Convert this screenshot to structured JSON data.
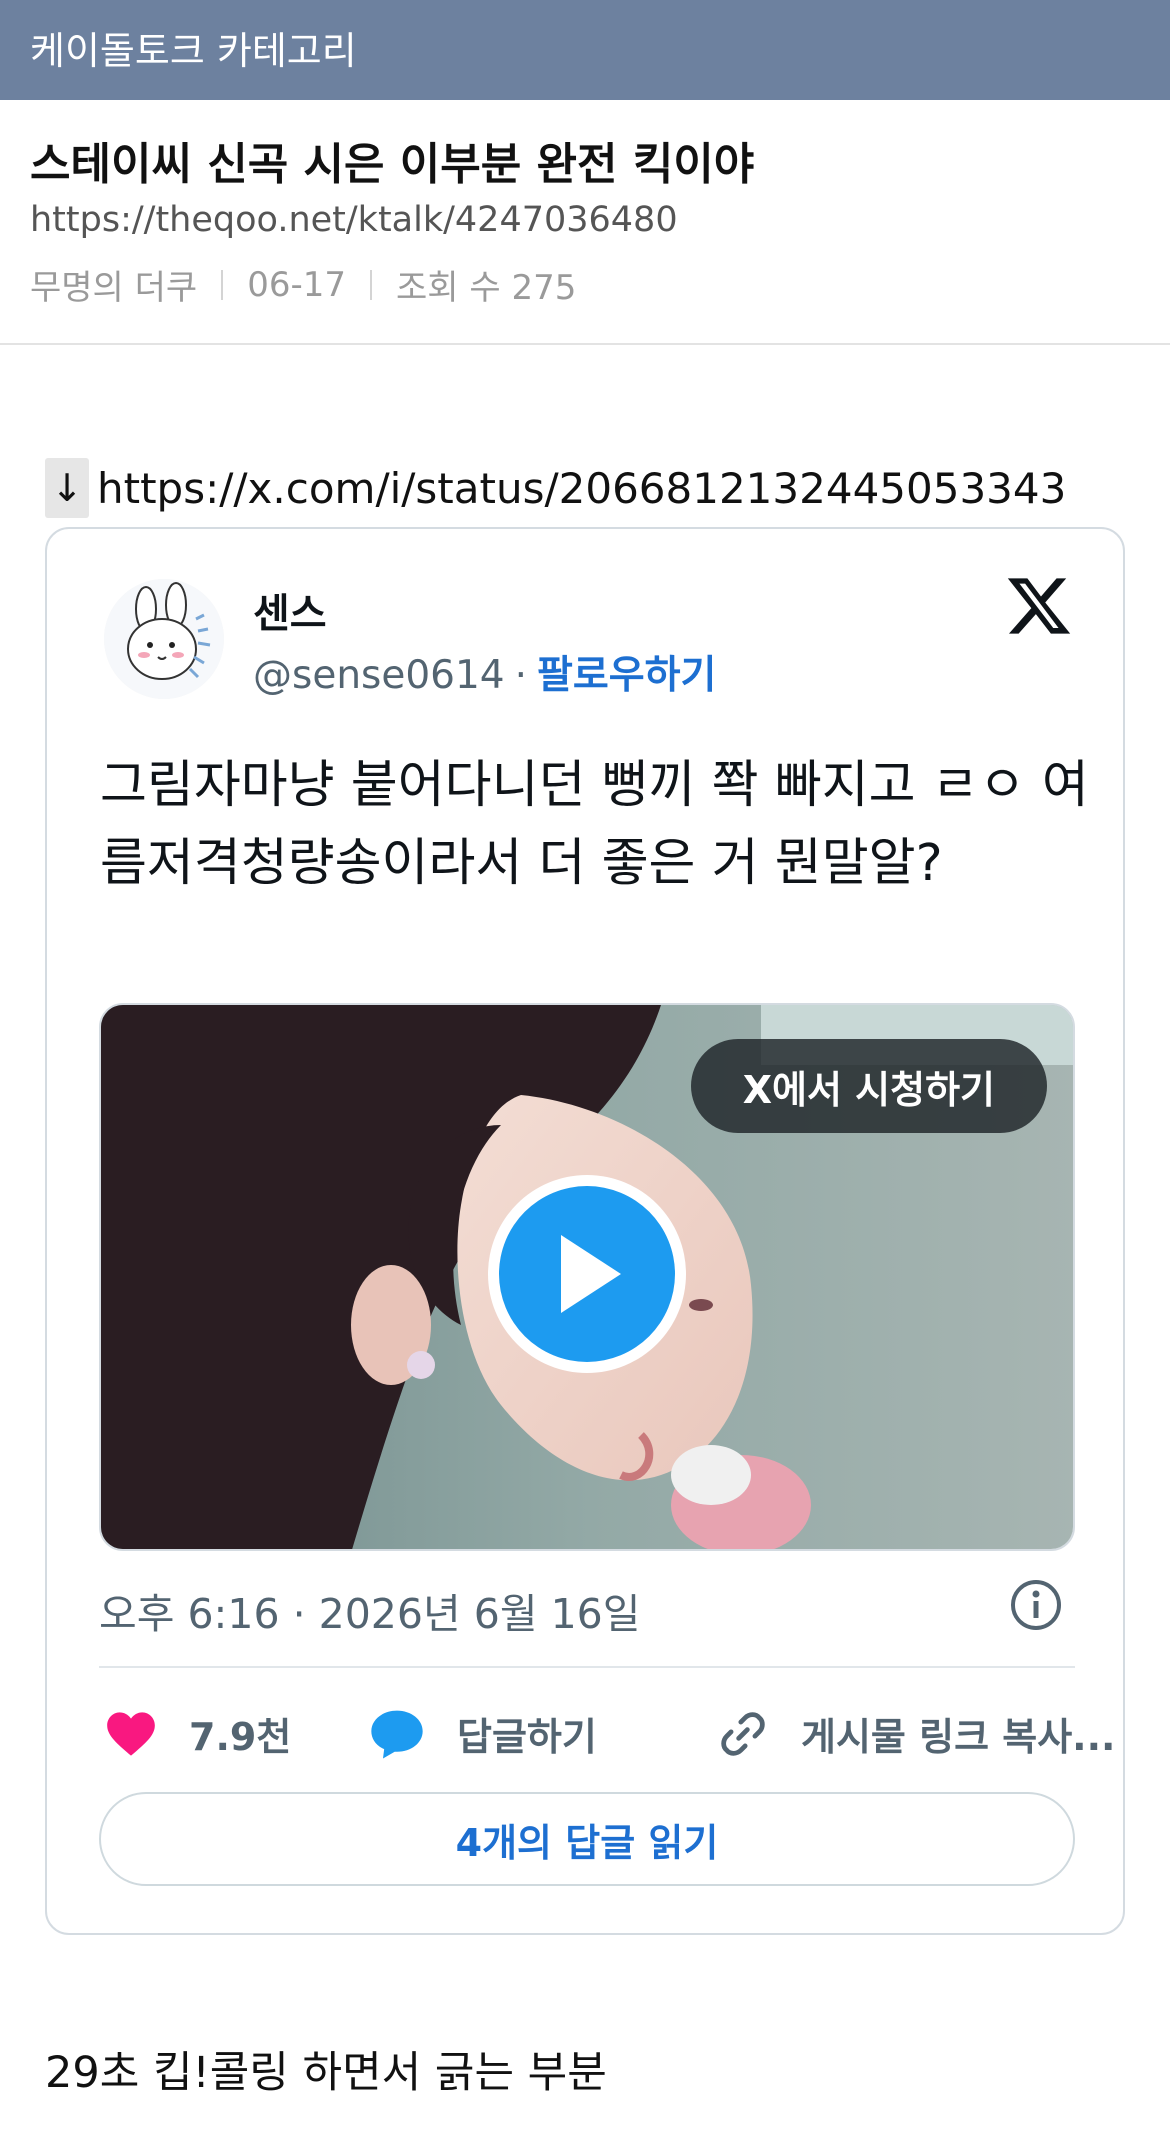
{
  "header": {
    "category": "케이돌토크 카테고리"
  },
  "post": {
    "title": "스테이씨 신곡 시은 이부분 완전 킥이야",
    "url": "https://theqoo.net/ktalk/4247036480",
    "author": "무명의 더쿠",
    "date": "06-17",
    "views": "조회 수 275"
  },
  "embed_link": {
    "arrow": "↓",
    "url": "https://x.com/i/status/2066812132445053343"
  },
  "tweet": {
    "display_name": "센스",
    "handle": "@sense0614",
    "separator": "·",
    "follow_label": "팔로우하기",
    "text": "그림자마냥 붙어다니던 뻥끼 쫙 빠지고 ㄹㅇ 여름저격청량송이라서 더 좋은 거 뭔말알?",
    "media": {
      "watch_label": "X에서 시청하기",
      "play_icon": "play-icon"
    },
    "timestamp": "오후 6:16 · 2026년 6월 16일",
    "actions": {
      "likes": "7.9천",
      "reply_label": "답글하기",
      "copy_label": "게시물 링크 복사..."
    },
    "read_replies_label": "4개의 답글 읽기"
  },
  "body_text": "29초 킵!콜링 하면서 긁는 부분",
  "colors": {
    "header_bg": "#6d819f",
    "link_blue": "#1d6fd1",
    "like_pink": "#f91880",
    "reply_blue": "#1d9bf0",
    "play_blue": "#1d9bf0"
  }
}
